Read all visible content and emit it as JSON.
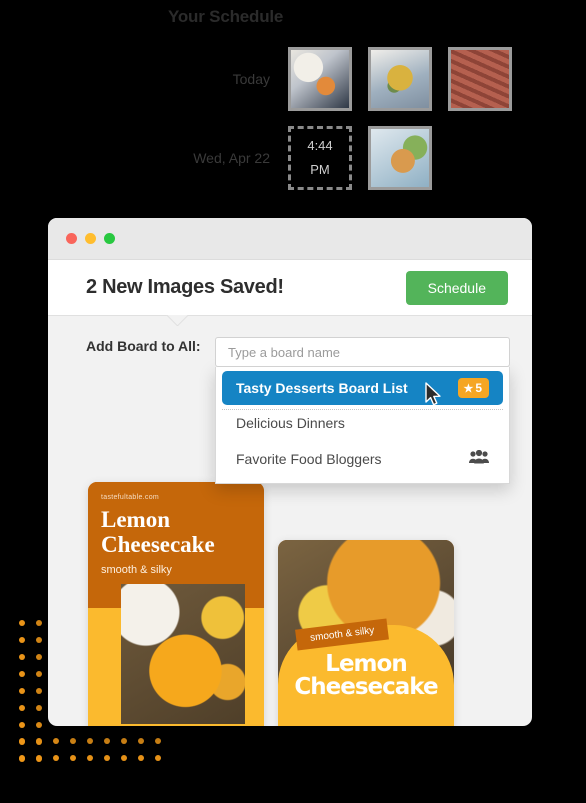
{
  "schedule": {
    "title": "Your Schedule",
    "rows": [
      {
        "label": "Today",
        "thumbs": [
          "food-thumb-carrots",
          "food-thumb-potato-salad",
          "food-thumb-bacon-asparagus"
        ],
        "slot": null
      },
      {
        "label": "Wed, Apr 22",
        "thumbs": [
          "food-thumb-salmon-peas"
        ],
        "slot": {
          "time": "4:44",
          "meridiem": "PM"
        }
      }
    ]
  },
  "window": {
    "traffic_lights": [
      "close",
      "minimize",
      "maximize"
    ],
    "header": {
      "title": "2 New Images Saved!",
      "schedule_button": "Schedule"
    },
    "board_label": "Add Board to All:"
  },
  "typeahead": {
    "placeholder": "Type a board name",
    "value": "",
    "items": [
      {
        "label": "Tasty Desserts Board List",
        "selected": true,
        "badge": "5",
        "badge_icon": "star-icon",
        "shared": false
      },
      {
        "label": "Delicious Dinners",
        "selected": false,
        "badge": null,
        "badge_icon": null,
        "shared": false
      },
      {
        "label": "Favorite Food Bloggers",
        "selected": false,
        "badge": null,
        "badge_icon": null,
        "shared": true
      }
    ]
  },
  "cards": [
    {
      "domain": "tastefultable.com",
      "title_line1": "Lemon",
      "title_line2": "Cheesecake",
      "subtitle": "smooth & silky",
      "style": "left"
    },
    {
      "domain": "",
      "title_line1": "Lemon",
      "title_line2": "Cheesecake",
      "subtitle": "smooth & silky",
      "style": "right"
    }
  ],
  "colors": {
    "background": "#000000",
    "accent_orange": "#F09819",
    "brand_green": "#53b45a",
    "selection_blue": "#1584c4",
    "badge_orange": "#F5A623",
    "card_brown": "#C5670A",
    "card_yellow": "#FBBA2E"
  }
}
